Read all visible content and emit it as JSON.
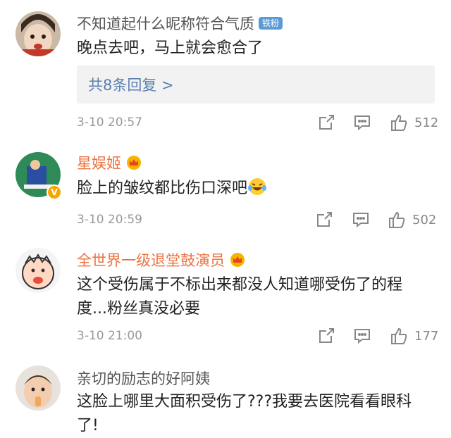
{
  "comments": [
    {
      "username": "不知道起什么昵称符合气质",
      "badge": "铁粉",
      "text": "晚点去吧，马上就会愈合了",
      "replies_link": "共8条回复 >",
      "time": "3-10 20:57",
      "likes": "512"
    },
    {
      "username": "星娱姬",
      "verified_mark": "V",
      "text": "脸上的皱纹都比伤口深吧",
      "time": "3-10 20:59",
      "likes": "502"
    },
    {
      "username": "全世界一级退堂鼓演员",
      "text_line1": "这个受伤属于不标出来都没人知道哪受伤了的程",
      "text_line2": "度...粉丝真没必要",
      "time": "3-10 21:00",
      "likes": "177"
    },
    {
      "username": "亲切的励志的好阿姨",
      "text_line1": "这脸上哪里大面积受伤了???我要去医院看看眼科",
      "text_line2": "了!"
    }
  ],
  "icons": {
    "share": "share-icon",
    "comment": "comment-icon",
    "like": "thumbs-up-icon",
    "crown": "vip-crown-icon",
    "emoji": "laughing-tears-emoji"
  },
  "colors": {
    "vip_name": "#eb7340",
    "link": "#5b7fb0",
    "meta": "#999999",
    "fan_badge": "#5b9bd5"
  }
}
